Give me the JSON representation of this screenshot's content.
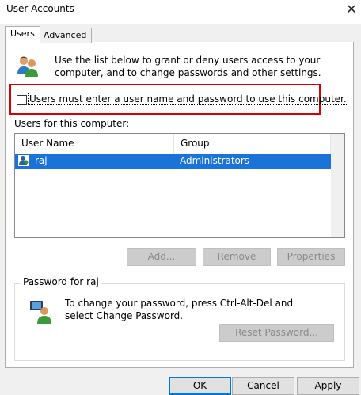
{
  "window": {
    "title": "User Accounts",
    "close_icon": "close-icon"
  },
  "tabs": [
    {
      "label": "Users",
      "active": true
    },
    {
      "label": "Advanced",
      "active": false
    }
  ],
  "intro": {
    "icon": "users-icon",
    "text": "Use the list below to grant or deny users access to your computer, and to change passwords and other settings."
  },
  "checkbox": {
    "label": "Users must enter a user name and password to use this computer.",
    "checked": false,
    "highlight_color": "#d60000"
  },
  "users_list": {
    "label": "Users for this computer:",
    "columns": [
      "User Name",
      "Group"
    ],
    "rows": [
      {
        "user_name": "raj",
        "group": "Administrators",
        "selected": true
      }
    ],
    "selection_color": "#1a73d9"
  },
  "list_buttons": {
    "add": "Add...",
    "remove": "Remove",
    "properties": "Properties"
  },
  "password_group": {
    "label": "Password for raj",
    "text": "To change your password, press Ctrl-Alt-Del and select Change Password.",
    "reset_button": "Reset Password..."
  },
  "footer": {
    "ok": "OK",
    "cancel": "Cancel",
    "apply": "Apply"
  }
}
